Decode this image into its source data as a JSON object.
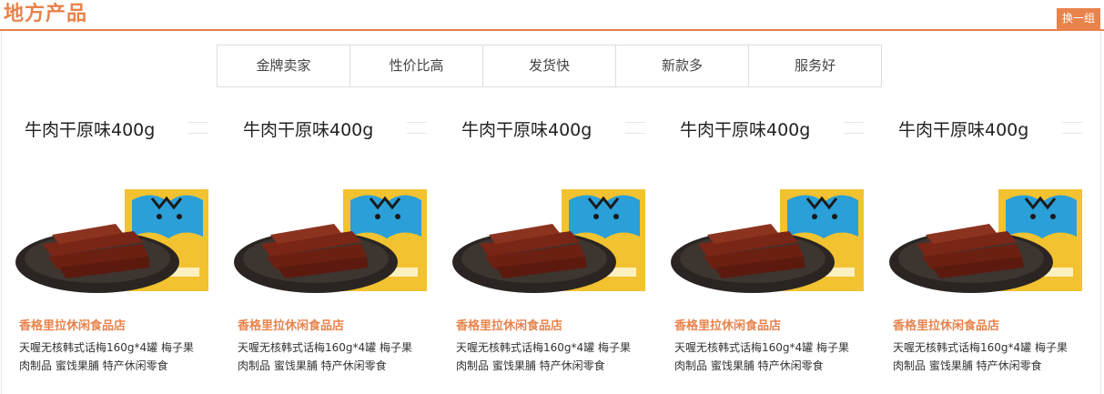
{
  "header": {
    "title": "地方产品",
    "swap_label": "换一组"
  },
  "filters": [
    "金牌卖家",
    "性价比高",
    "发货快",
    "新款多",
    "服务好"
  ],
  "products": [
    {
      "image_title": "牛肉干原味400g",
      "shop": "香格里拉休闲食品店",
      "description": "天喔无核韩式话梅160g*4罐 梅子果肉制品 蜜饯果脯 特产休闲零食"
    },
    {
      "image_title": "牛肉干原味400g",
      "shop": "香格里拉休闲食品店",
      "description": "天喔无核韩式话梅160g*4罐 梅子果肉制品 蜜饯果脯 特产休闲零食"
    },
    {
      "image_title": "牛肉干原味400g",
      "shop": "香格里拉休闲食品店",
      "description": "天喔无核韩式话梅160g*4罐 梅子果肉制品 蜜饯果脯 特产休闲零食"
    },
    {
      "image_title": "牛肉干原味400g",
      "shop": "香格里拉休闲食品店",
      "description": "天喔无核韩式话梅160g*4罐 梅子果肉制品 蜜饯果脯 特产休闲零食"
    },
    {
      "image_title": "牛肉干原味400g",
      "shop": "香格里拉休闲食品店",
      "description": "天喔无核韩式话梅160g*4罐 梅子果肉制品 蜜饯果脯 特产休闲零食"
    }
  ],
  "colors": {
    "accent": "#e8834c",
    "border": "#dddddd",
    "package_yellow": "#f2c230",
    "package_blue": "#2a9fd8"
  }
}
